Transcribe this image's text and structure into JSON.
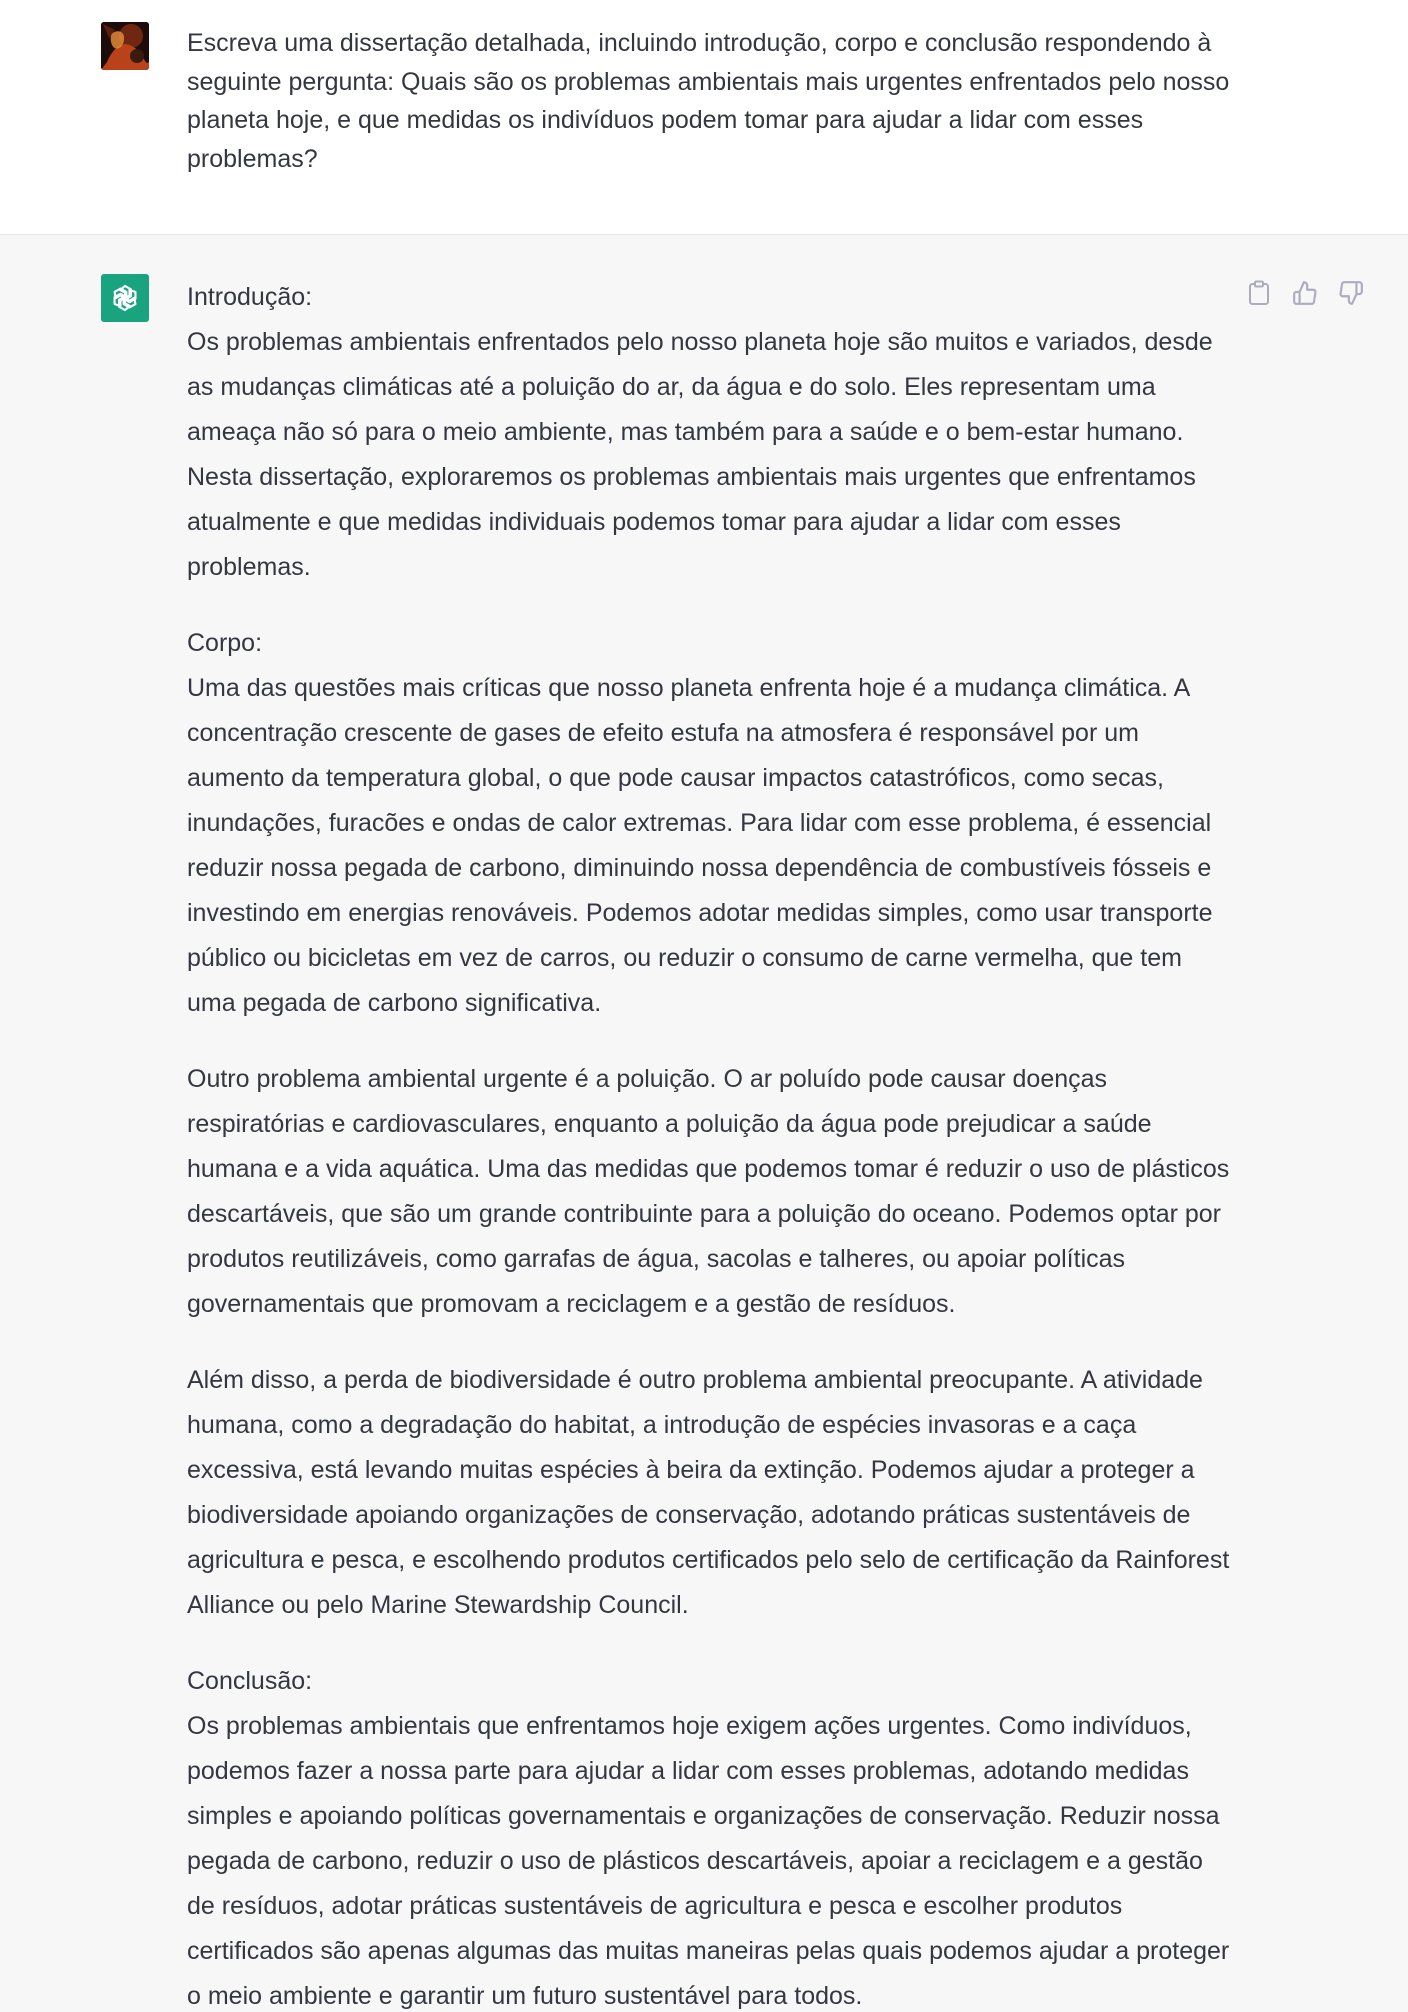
{
  "user_message": {
    "text": "Escreva uma dissertação detalhada, incluindo introdução, corpo e conclusão respondendo à seguinte pergunta: Quais são os problemas ambientais mais urgentes enfrentados pelo nosso planeta hoje, e que medidas os indivíduos podem tomar para ajudar a lidar com esses problemas?"
  },
  "assistant_message": {
    "intro_heading": "Introdução:",
    "intro": "Os problemas ambientais enfrentados pelo nosso planeta hoje são muitos e variados, desde as mudanças climáticas até a poluição do ar, da água e do solo. Eles representam uma ameaça não só para o meio ambiente, mas também para a saúde e o bem-estar humano. Nesta dissertação, exploraremos os problemas ambientais mais urgentes que enfrentamos atualmente e que medidas individuais podemos tomar para ajudar a lidar com esses problemas.",
    "body_heading": "Corpo:",
    "body_p1": "Uma das questões mais críticas que nosso planeta enfrenta hoje é a mudança climática. A concentração crescente de gases de efeito estufa na atmosfera é responsável por um aumento da temperatura global, o que pode causar impactos catastróficos, como secas, inundações, furacões e ondas de calor extremas. Para lidar com esse problema, é essencial reduzir nossa pegada de carbono, diminuindo nossa dependência de combustíveis fósseis e investindo em energias renováveis. Podemos adotar medidas simples, como usar transporte público ou bicicletas em vez de carros, ou reduzir o consumo de carne vermelha, que tem uma pegada de carbono significativa.",
    "body_p2": "Outro problema ambiental urgente é a poluição. O ar poluído pode causar doenças respiratórias e cardiovasculares, enquanto a poluição da água pode prejudicar a saúde humana e a vida aquática. Uma das medidas que podemos tomar é reduzir o uso de plásticos descartáveis, que são um grande contribuinte para a poluição do oceano. Podemos optar por produtos reutilizáveis, como garrafas de água, sacolas e talheres, ou apoiar políticas governamentais que promovam a reciclagem e a gestão de resíduos.",
    "body_p3": "Além disso, a perda de biodiversidade é outro problema ambiental preocupante. A atividade humana, como a degradação do habitat, a introdução de espécies invasoras e a caça excessiva, está levando muitas espécies à beira da extinção. Podemos ajudar a proteger a biodiversidade apoiando organizações de conservação, adotando práticas sustentáveis de agricultura e pesca, e escolhendo produtos certificados pelo selo de certificação da Rainforest Alliance ou pelo Marine Stewardship Council.",
    "conclusion_heading": "Conclusão:",
    "conclusion": "Os problemas ambientais que enfrentamos hoje exigem ações urgentes. Como indivíduos, podemos fazer a nossa parte para ajudar a lidar com esses problemas, adotando medidas simples e apoiando políticas governamentais e organizações de conservação. Reduzir nossa pegada de carbono, reduzir o uso de plásticos descartáveis, apoiar a reciclagem e a gestão de resíduos, adotar práticas sustentáveis de agricultura e pesca e escolher produtos certificados são apenas algumas das muitas maneiras pelas quais podemos ajudar a proteger o meio ambiente e garantir um futuro sustentável para todos."
  },
  "actions": [
    {
      "icon": "clipboard-icon"
    },
    {
      "icon": "thumbs-up-icon"
    },
    {
      "icon": "thumbs-down-icon"
    }
  ],
  "colors": {
    "assistant_bg": "#f7f7f8",
    "bot_avatar": "#19a37f",
    "text": "#353740",
    "icon": "#acacbe"
  }
}
